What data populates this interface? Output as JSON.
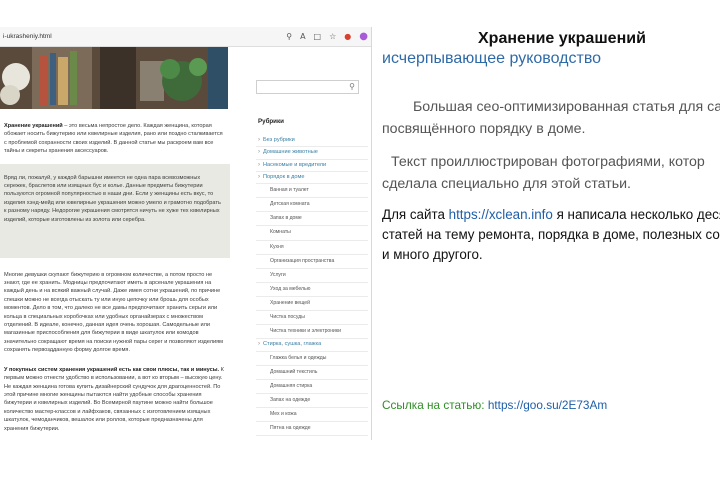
{
  "browser": {
    "url": "i-ukrasheniy.html",
    "icons": [
      "search-icon",
      "reader-icon",
      "bookmark-icon",
      "star-icon",
      "extension-icon",
      "profile-icon"
    ]
  },
  "article": {
    "p1_bold": "Хранение украшений",
    "p1_rest": " – это весьма непростое дело. Каждая женщина, которая обожает носить бижутерию или ювелирные изделия, рано или поздно сталкивается с проблемой сохранности своих изделий. В данной статье мы раскроем вам все тайны и секреты хранения аксессуаров.",
    "quote": "Вряд ли, пожалуй, у каждой барышни имеется не одна пара всевозможных сережек, браслетов или изящных бус и колье. Данные предметы бижутерии пользуются огромной популярностью в наши дни. Если у женщины есть вкус, то изделия хэнд-мейд или ювелирные украшения можно умело и грамотно подобрать к разному наряду. Недорогие украшения смотрятся ничуть не хуже тех ювелирных изделий, которые изготовлены из золота или серебра.",
    "p3": "Многие девушки скупают бижутерию в огромном количестве, а потом просто не знают, где ее хранить. Модницы предпочитают иметь в арсенале украшения на каждый день и на всякий важный случай. Даже имея сотни украшений, по причине спешки можно не всегда отыскать ту или иную цепочку или брошь для особых моментов. Дело в том, что далеко не все дамы предпочитают хранить серьги или кольца в специальных коробочках или удобных органайзерах с множеством отделений. В идеале, конечно, данная идея очень хорошая. Самодельные или магазинные приспособления для бижутерии в виде шкатулок или комодов значительно сокращают время на поиски нужной пары серег и позволяют изделиям сохранять первоздданную форму долгое время.",
    "p4_bold": "У покупных систем хранения украшений есть как свои плюсы, так и минусы.",
    "p4_rest": " К первым можно отнести удобство в использовании, а вот ко вторым – высокую цену. Не каждая женщина готова купить дизайнерский сундучок для драгоценностей. По этой причине многие женщины пытаются найти удобные способы хранения бижутерии и ювелирных изделий. Во Всемирной паутине можно найти большое количество мастер-классов и лайфхаков, связанных с изготовлением изящных шкатулок, чемоданчиков, вешалок или роллов, которые предназначены для хранения бижутерии."
  },
  "sidebar": {
    "rubrics_title": "Рубрики",
    "categories": [
      {
        "label": "Без рубрики",
        "level": 0
      },
      {
        "label": "Домашние животные",
        "level": 0
      },
      {
        "label": "Насекомые и вредители",
        "level": 0
      },
      {
        "label": "Порядок в доме",
        "level": 0
      },
      {
        "label": "Ванная и туалет",
        "level": 1
      },
      {
        "label": "Детская комната",
        "level": 1
      },
      {
        "label": "Запах в доме",
        "level": 1
      },
      {
        "label": "Комнаты",
        "level": 1
      },
      {
        "label": "Кухня",
        "level": 1
      },
      {
        "label": "Организация пространства",
        "level": 1
      },
      {
        "label": "Услуги",
        "level": 1
      },
      {
        "label": "Уход за мебелью",
        "level": 1
      },
      {
        "label": "Хранение вещей",
        "level": 1
      },
      {
        "label": "Чистка посуды",
        "level": 1
      },
      {
        "label": "Чистка техники и электроники",
        "level": 1
      },
      {
        "label": "Стирка, сушка, глажка",
        "level": 0
      },
      {
        "label": "Глажка белья и одежды",
        "level": 1
      },
      {
        "label": "Домашний текстиль",
        "level": 1
      },
      {
        "label": "Домашняя стирка",
        "level": 1
      },
      {
        "label": "Запах на одежде",
        "level": 1
      },
      {
        "label": "Мех и кожа",
        "level": 1
      },
      {
        "label": "Пятна на одежде",
        "level": 1
      }
    ]
  },
  "slide": {
    "title": "Хранение украшений",
    "subtitle": "исчерпывающее руководство",
    "text1_line1": "Большая сео-оптимизированная статья для са",
    "text1_line2": "посвящённого порядку в доме.",
    "text2_line1": "Текст  проиллюстрирован  фотографиями,  котор",
    "text2_line2": "сделала специально для этой статьи.",
    "text3_pre": "Для сайта ",
    "text3_link": "https://xclean.info",
    "text3_post": " я написала несколько деся",
    "text3_line2": "статей на тему ремонта, порядка в доме, полезных сов",
    "text3_line3": "и много другого.",
    "link_label": "Ссылка на статью: ",
    "link_url": "https://goo.su/2E73Am"
  }
}
